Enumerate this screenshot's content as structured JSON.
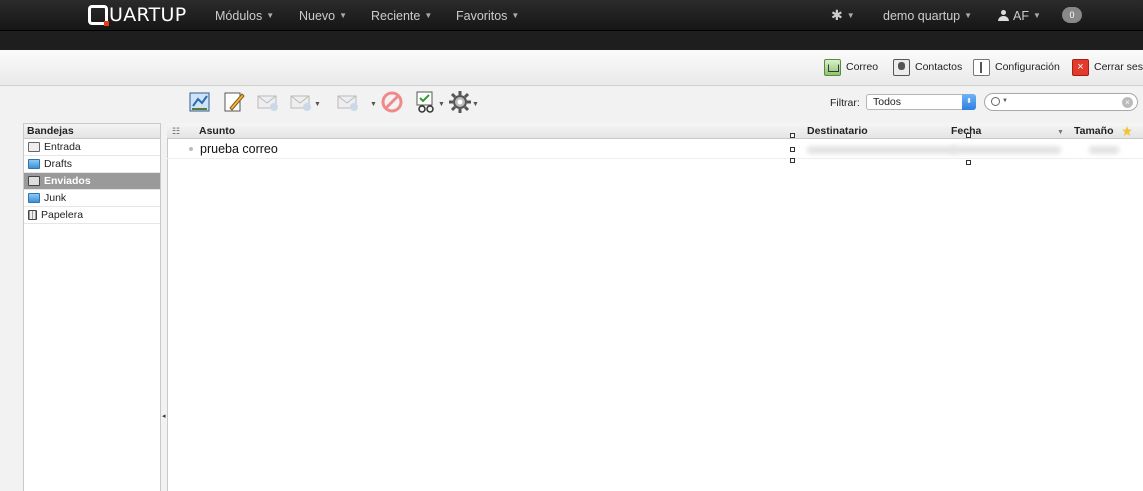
{
  "navbar": {
    "brand_first": "Q",
    "brand_rest": "UARTUP",
    "menus": [
      "Módulos",
      "Nuevo",
      "Reciente",
      "Favoritos"
    ],
    "user_menu": "demo quartup",
    "initials": "AF",
    "notifications": "0",
    "gear_icon": "gear-icon"
  },
  "header": {
    "links": [
      "Correo",
      "Contactos",
      "Configuración",
      "Cerrar sesi"
    ]
  },
  "toolbar": {
    "icons": [
      "check-mail-icon",
      "compose-icon",
      "reply-icon",
      "reply-all-icon",
      "forward-icon",
      "delete-icon",
      "mark-icon",
      "more-actions-icon"
    ]
  },
  "filter": {
    "label": "Filtrar:",
    "selected": "Todos",
    "search_value": ""
  },
  "folders": {
    "header": "Bandejas",
    "items": [
      {
        "label": "Entrada",
        "icon": "inbox-icon"
      },
      {
        "label": "Drafts",
        "icon": "folder-icon"
      },
      {
        "label": "Enviados",
        "icon": "sent-icon",
        "selected": true
      },
      {
        "label": "Junk",
        "icon": "folder-icon"
      },
      {
        "label": "Papelera",
        "icon": "trash-icon"
      }
    ]
  },
  "list": {
    "columns": {
      "subject": "Asunto",
      "recipient": "Destinatario",
      "date": "Fecha",
      "size": "Tamaño"
    },
    "rows": [
      {
        "subject": "prueba correo"
      }
    ]
  }
}
